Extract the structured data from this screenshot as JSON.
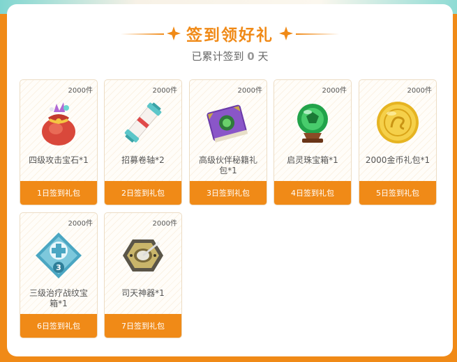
{
  "header": {
    "title": "签到领好礼",
    "subtitle_prefix": "已累计签到 ",
    "signed_days": "0",
    "subtitle_suffix": " 天"
  },
  "colors": {
    "accent": "#f08a17",
    "panel": "#ffffff",
    "card_border": "#ecdcc4"
  },
  "rewards": [
    {
      "qty": "2000件",
      "name": "四级攻击宝石*1",
      "footer": "1日签到礼包",
      "icon": "gem-pouch-icon"
    },
    {
      "qty": "2000件",
      "name": "招募卷轴*2",
      "footer": "2日签到礼包",
      "icon": "scroll-icon"
    },
    {
      "qty": "2000件",
      "name": "高级伙伴秘籍礼包*1",
      "footer": "3日签到礼包",
      "icon": "book-icon"
    },
    {
      "qty": "2000件",
      "name": "启灵珠宝箱*1",
      "footer": "4日签到礼包",
      "icon": "orb-icon"
    },
    {
      "qty": "2000件",
      "name": "2000金币礼包*1",
      "footer": "5日签到礼包",
      "icon": "gold-coin-icon"
    },
    {
      "qty": "2000件",
      "name": "三级治疗战纹宝箱*1",
      "footer": "6日签到礼包",
      "icon": "heal-rune-icon",
      "badge": "3"
    },
    {
      "qty": "2000件",
      "name": "司天神器*1",
      "footer": "7日签到礼包",
      "icon": "compass-artifact-icon"
    }
  ]
}
